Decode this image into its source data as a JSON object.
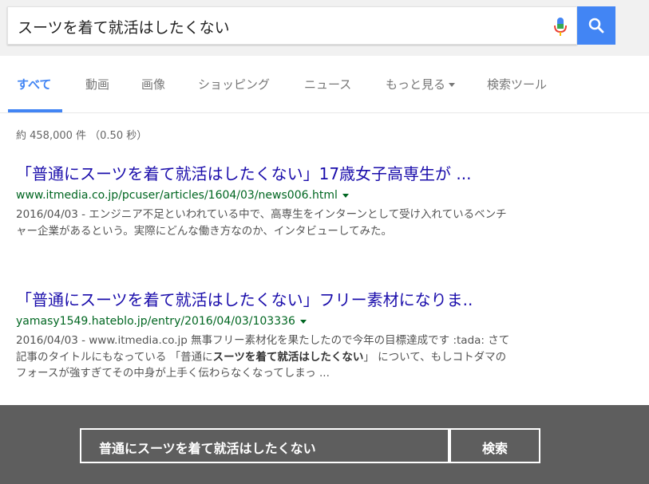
{
  "search": {
    "query": "スーツを着て就活はしたくない"
  },
  "tabs": [
    {
      "label": "すべて"
    },
    {
      "label": "動画"
    },
    {
      "label": "画像"
    },
    {
      "label": "ショッピング"
    },
    {
      "label": "ニュース"
    },
    {
      "label": "もっと見る"
    },
    {
      "label": "検索ツール"
    }
  ],
  "stats": "約 458,000 件 （0.50 秒）",
  "results": [
    {
      "title": "「普通にスーツを着て就活はしたくない」17歳女子高専生が ...",
      "url": "www.itmedia.co.jp/pcuser/articles/1604/03/news006.html",
      "snippet": "2016/04/03 - エンジニア不足といわれている中で、高専生をインターンとして受け入れているベンチャー企業があるという。実際にどんな働き方なのか、インタビューしてみた。"
    },
    {
      "title": "「普通にスーツを着て就活はしたくない」フリー素材になりま..",
      "url": "yamasy1549.hateblo.jp/entry/2016/04/03/103336",
      "snippet_pre": "2016/04/03 - www.itmedia.co.jp 無事フリー素材化を果たしたので今年の目標達成です :tada: さて記事のタイトルにもなっている 「普通に",
      "snippet_bold": "スーツを着て就活はしたくない",
      "snippet_post": "」 について、もしコトダマのフォースが強すぎてその中身が上手く伝わらなくなってしまっ ..."
    }
  ],
  "overlay": {
    "input_text": "普通にスーツを着て就活はしたくない",
    "button_label": "検索"
  },
  "colors": {
    "accent": "#4285f4",
    "link": "#1a0dab",
    "url": "#006621",
    "overlay_bg": "#5e5e5e"
  }
}
